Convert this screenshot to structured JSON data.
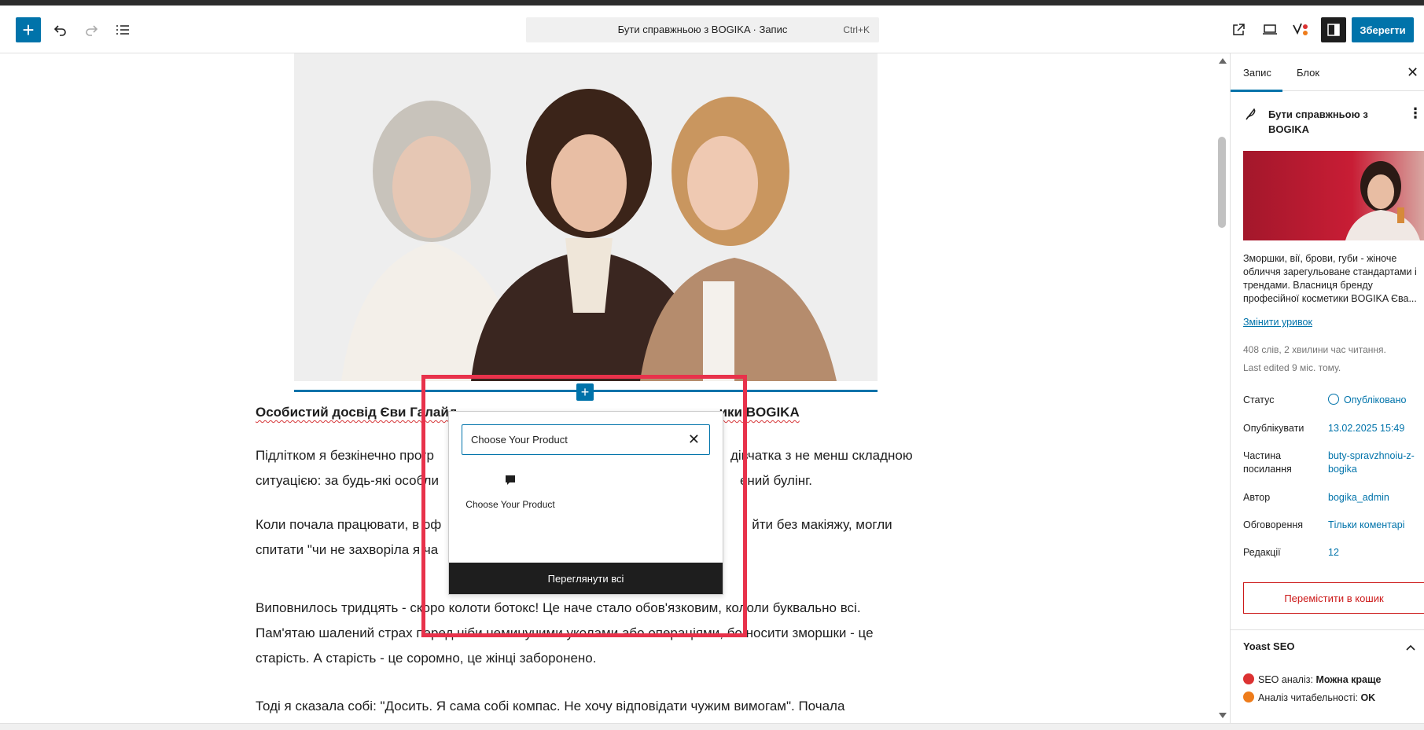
{
  "toolbar": {
    "add_label": "+",
    "doc_title": "Бути справжньою з BOGIKA · Запис",
    "shortcut": "Ctrl+K",
    "save_label": "Зберегти"
  },
  "content": {
    "heading": "Особистий досвід Єви Галайд… BOGIKA",
    "heading_left": "Особистий досвід Єви Галайд",
    "heading_right": "ики BOGIKA",
    "p1_line1": "Підлітком я безкінечно прогр",
    "p1_line1_right": "дівчатка з не менш складною",
    "p1_line2_left": "ситуацією: за будь-які особли",
    "p1_line2_right": "ений булінг.",
    "p2_line1_left": "Коли почала працювати, в оф",
    "p2_line1_right": "йти без макіяжу, могли",
    "p2_line2_left": "спитати \"чи не захворіла я ча",
    "p3_line1": "Виповнилось тридцять - скоро колоти ботокс! Це наче стало обов'язковим, кололи буквально всі.",
    "p3_line2": "Пам'ятаю шалений страх перед ніби неминучими уколами або операціями, бо носити зморшки - це",
    "p3_line3": "старість. А старість - це соромно, це жінці заборонено.",
    "p4_line1": "Тоді я сказала собі: \"Досить. Я сама собі компас. Не хочу відповідати чужим вимогам\". Почала"
  },
  "inserter": {
    "search_value": "Choose Your Product",
    "result_label": "Choose Your Product",
    "view_all": "Переглянути всі"
  },
  "sidebar": {
    "tab_post": "Запис",
    "tab_block": "Блок",
    "post_title": "Бути справжньою з BOGIKA",
    "excerpt": "Зморшки, вії, брови, губи - жіноче обличчя зарегульоване стандартами і трендами. Власниця бренду професійної косметики BOGIKA Єва...",
    "edit_excerpt": "Змінити уривок",
    "word_count": "408 слів, 2 хвилини час читання.",
    "last_edited": "Last edited 9 міс. тому.",
    "status_label": "Статус",
    "status_value": "Опубліковано",
    "publish_label": "Опублікувати",
    "publish_value": "13.02.2025 15:49",
    "link_label": "Частина посилання",
    "link_value": "buty-spravzhnoiu-z-bogika",
    "author_label": "Автор",
    "author_value": "bogika_admin",
    "comments_label": "Обговорення",
    "comments_value": "Тільки коментарі",
    "revisions_label": "Редакції",
    "revisions_value": "12",
    "trash_label": "Перемістити в кошик",
    "yoast_title": "Yoast SEO",
    "seo_label": "SEO аналіз:",
    "seo_value": "Можна краще",
    "read_label": "Аналіз читабельності:",
    "read_value": "OK"
  },
  "colors": {
    "accent": "#0073aa",
    "highlight": "#e8324b",
    "danger": "#cc1818",
    "seo_bad": "#dc3232",
    "seo_ok": "#ee7c1b"
  }
}
